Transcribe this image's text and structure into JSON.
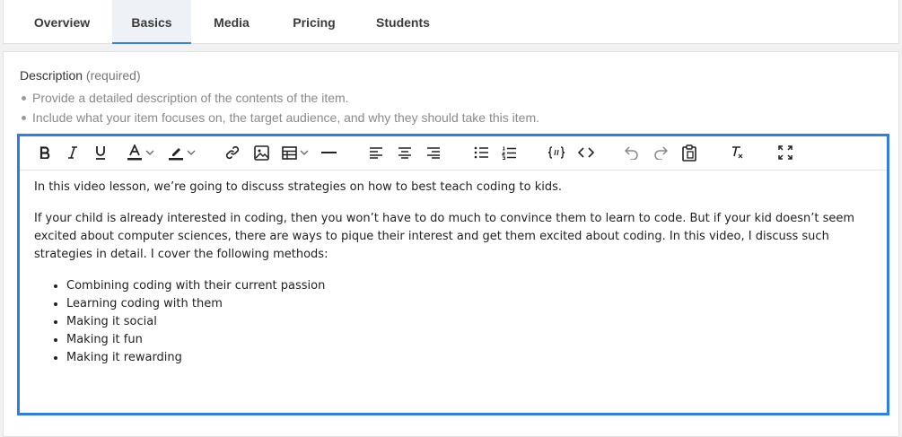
{
  "tabs": [
    {
      "label": "Overview"
    },
    {
      "label": "Basics",
      "active": true
    },
    {
      "label": "Media"
    },
    {
      "label": "Pricing"
    },
    {
      "label": "Students"
    }
  ],
  "field": {
    "label": "Description",
    "required": "(required)",
    "hints": [
      "Provide a detailed description of the contents of the item.",
      "Include what your item focuses on, the target audience, and why they should take this item."
    ]
  },
  "toolbar": {
    "icons": [
      "bold-icon",
      "italic-icon",
      "underline-icon",
      "text-color-icon",
      "highlight-icon",
      "link-icon",
      "image-icon",
      "table-icon",
      "horizontal-rule-icon",
      "align-left-icon",
      "align-center-icon",
      "align-right-icon",
      "bullet-list-icon",
      "numbered-list-icon",
      "code-block-icon",
      "code-view-icon",
      "undo-icon",
      "redo-icon",
      "paste-icon",
      "clear-format-icon",
      "fullscreen-icon"
    ]
  },
  "editor": {
    "paragraph1": "In this video lesson, we’re going to discuss strategies on how to best teach coding to kids.",
    "paragraph2": "If your child is already interested in coding, then you won’t have to do much to convince them to learn to code. But if your kid doesn’t seem excited about computer sciences, there are ways to pique their interest and get them excited about coding. In this video, I discuss such strategies in detail. I cover the following methods:",
    "list": [
      "Combining coding with their current passion",
      "Learning coding with them",
      "Making it social",
      "Making it fun",
      "Making it rewarding"
    ]
  },
  "colors": {
    "accent": "#2d7ee6",
    "tab_active_bg": "#eef1f6"
  }
}
